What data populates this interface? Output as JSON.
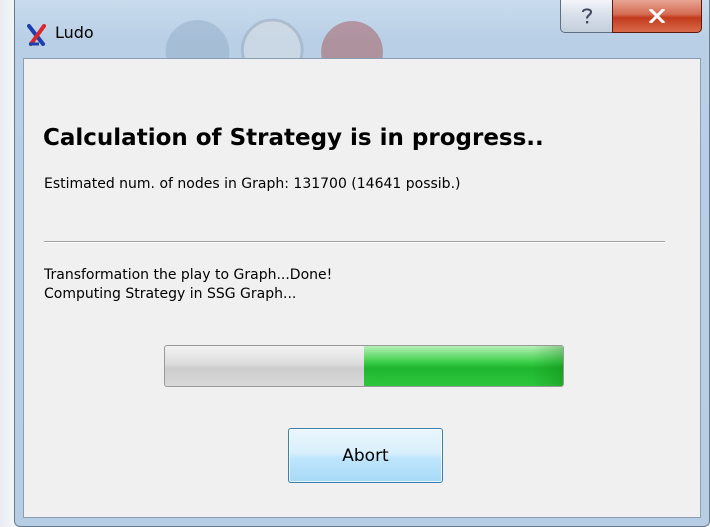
{
  "window": {
    "title": "Ludo",
    "icon": "ludo-app-icon",
    "help_icon": "question-mark-icon",
    "close_icon": "close-x-icon"
  },
  "dialog": {
    "heading": "Calculation of Strategy is in progress..",
    "estimate": "Estimated num. of nodes in Graph: 131700 (14641 possib.)",
    "log": [
      "Transformation the play to Graph...Done!",
      "Computing Strategy in SSG Graph..."
    ],
    "progress": {
      "filled_range": [
        0.5,
        1.0
      ]
    },
    "abort_label": "Abort"
  },
  "colors": {
    "progress_fill": "#22b832",
    "close_button": "#c43b1e",
    "focus_border": "#3c7fb1"
  }
}
